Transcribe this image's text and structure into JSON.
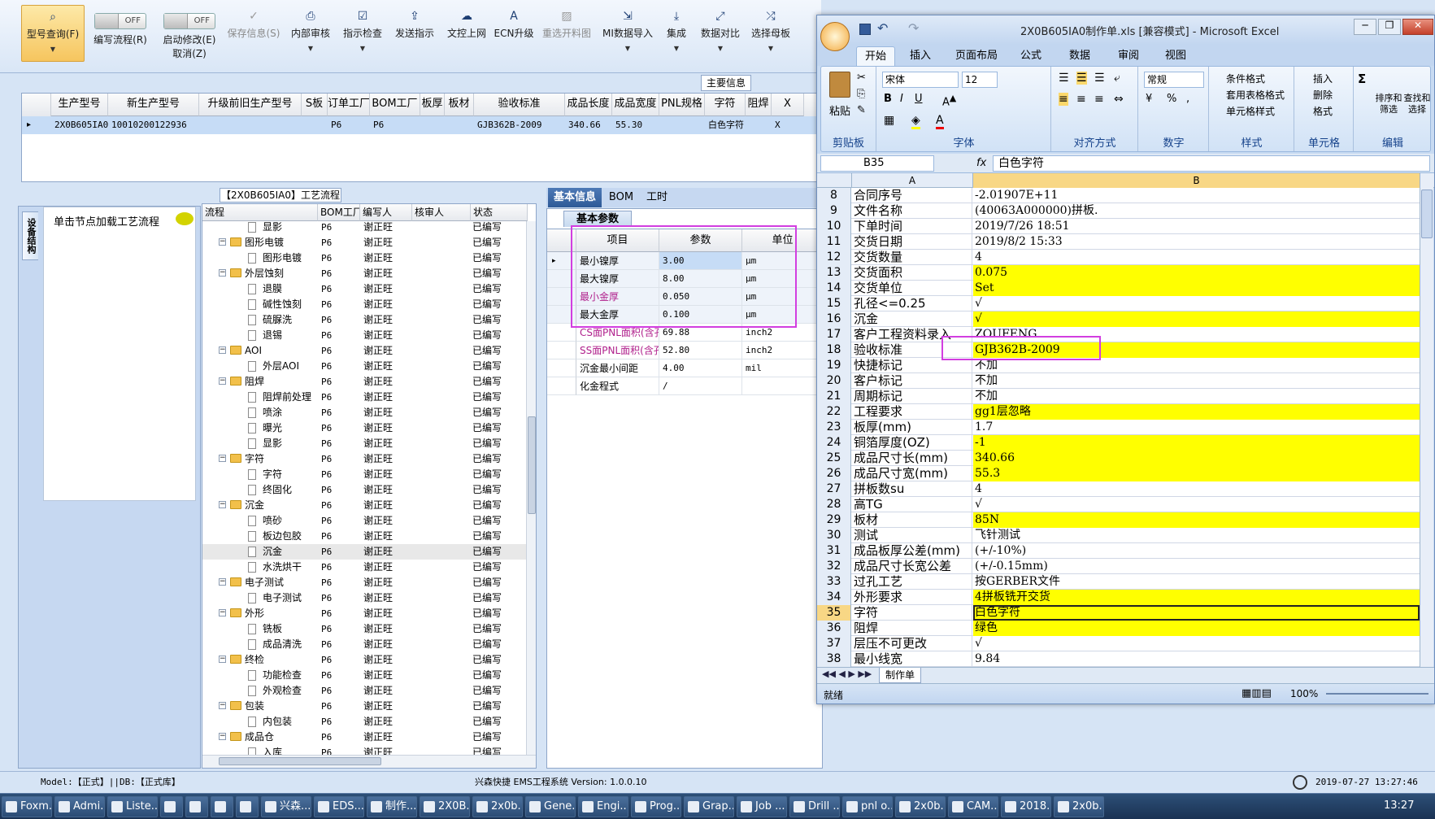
{
  "toolbar": {
    "buttons": [
      {
        "label": "型号查询(F)",
        "icon": "search-icon"
      },
      {
        "label": "编写流程(R)",
        "toggle": "OFF"
      },
      {
        "label": "启动修改(E)",
        "sub": "取消(Z)",
        "toggle": "OFF"
      },
      {
        "label": "保存信息(S)",
        "icon": "check-icon"
      },
      {
        "label": "内部审核",
        "icon": "printer-icon"
      },
      {
        "label": "指示检查",
        "icon": "check-box-icon"
      },
      {
        "label": "发送指示",
        "icon": "upload-icon"
      },
      {
        "label": "文控上网",
        "icon": "cloud-upload-icon"
      },
      {
        "label": "ECN升级",
        "icon": "a-icon"
      },
      {
        "label": "重选开料图",
        "icon": "image-icon"
      },
      {
        "label": "MI数据导入",
        "icon": "import-icon"
      },
      {
        "label": "集成",
        "icon": "download-icon"
      },
      {
        "label": "数据对比",
        "icon": "compare-icon"
      },
      {
        "label": "选择母板",
        "icon": "shuffle-icon"
      }
    ]
  },
  "main_info": {
    "tab": "主要信息",
    "columns": [
      "生产型号",
      "新生产型号",
      "升级前旧生产型号",
      "S板",
      "订单工厂",
      "BOM工厂",
      "板厚",
      "板材",
      "验收标准",
      "成品长度",
      "成品宽度",
      "PNL规格",
      "字符",
      "阻焊",
      "X"
    ],
    "row": [
      "2X0B605IA0",
      "10010200122936",
      "",
      "",
      "P6",
      "P6",
      "",
      "",
      "GJB362B-2009",
      "340.66",
      "55.30",
      "",
      "白色字符",
      "",
      "X"
    ]
  },
  "left_panel": {
    "side_tab": "设备结构",
    "hint": "单击节点加载工艺流程"
  },
  "process": {
    "title": "【2X0B605IA0】工艺流程",
    "columns": [
      "流程",
      "BOM工厂",
      "编写人",
      "核审人",
      "状态"
    ],
    "rows": [
      {
        "name": "显影",
        "level": 2,
        "factory": "P6",
        "writer": "谢正旺",
        "status": "已编写"
      },
      {
        "name": "图形电镀",
        "level": 1,
        "factory": "P6",
        "writer": "谢正旺",
        "status": "已编写"
      },
      {
        "name": "图形电镀",
        "level": 2,
        "factory": "P6",
        "writer": "谢正旺",
        "status": "已编写"
      },
      {
        "name": "外层蚀刻",
        "level": 1,
        "factory": "P6",
        "writer": "谢正旺",
        "status": "已编写"
      },
      {
        "name": "退膜",
        "level": 2,
        "factory": "P6",
        "writer": "谢正旺",
        "status": "已编写"
      },
      {
        "name": "碱性蚀刻",
        "level": 2,
        "factory": "P6",
        "writer": "谢正旺",
        "status": "已编写"
      },
      {
        "name": "硫脲洗",
        "level": 2,
        "factory": "P6",
        "writer": "谢正旺",
        "status": "已编写"
      },
      {
        "name": "退锡",
        "level": 2,
        "factory": "P6",
        "writer": "谢正旺",
        "status": "已编写"
      },
      {
        "name": "AOI",
        "level": 1,
        "factory": "P6",
        "writer": "谢正旺",
        "status": "已编写"
      },
      {
        "name": "外层AOI",
        "level": 2,
        "factory": "P6",
        "writer": "谢正旺",
        "status": "已编写"
      },
      {
        "name": "阻焊",
        "level": 1,
        "factory": "P6",
        "writer": "谢正旺",
        "status": "已编写"
      },
      {
        "name": "阻焊前处理",
        "level": 2,
        "factory": "P6",
        "writer": "谢正旺",
        "status": "已编写"
      },
      {
        "name": "喷涂",
        "level": 2,
        "factory": "P6",
        "writer": "谢正旺",
        "status": "已编写"
      },
      {
        "name": "曝光",
        "level": 2,
        "factory": "P6",
        "writer": "谢正旺",
        "status": "已编写"
      },
      {
        "name": "显影",
        "level": 2,
        "factory": "P6",
        "writer": "谢正旺",
        "status": "已编写"
      },
      {
        "name": "字符",
        "level": 1,
        "factory": "P6",
        "writer": "谢正旺",
        "status": "已编写"
      },
      {
        "name": "字符",
        "level": 2,
        "factory": "P6",
        "writer": "谢正旺",
        "status": "已编写"
      },
      {
        "name": "终固化",
        "level": 2,
        "factory": "P6",
        "writer": "谢正旺",
        "status": "已编写"
      },
      {
        "name": "沉金",
        "level": 1,
        "factory": "P6",
        "writer": "谢正旺",
        "status": "已编写"
      },
      {
        "name": "喷砂",
        "level": 2,
        "factory": "P6",
        "writer": "谢正旺",
        "status": "已编写"
      },
      {
        "name": "板边包胶",
        "level": 2,
        "factory": "P6",
        "writer": "谢正旺",
        "status": "已编写"
      },
      {
        "name": "沉金",
        "level": 2,
        "factory": "P6",
        "writer": "谢正旺",
        "status": "已编写"
      },
      {
        "name": "水洗烘干",
        "level": 2,
        "factory": "P6",
        "writer": "谢正旺",
        "status": "已编写"
      },
      {
        "name": "电子测试",
        "level": 1,
        "factory": "P6",
        "writer": "谢正旺",
        "status": "已编写"
      },
      {
        "name": "电子测试",
        "level": 2,
        "factory": "P6",
        "writer": "谢正旺",
        "status": "已编写"
      },
      {
        "name": "外形",
        "level": 1,
        "factory": "P6",
        "writer": "谢正旺",
        "status": "已编写"
      },
      {
        "name": "铣板",
        "level": 2,
        "factory": "P6",
        "writer": "谢正旺",
        "status": "已编写"
      },
      {
        "name": "成品清洗",
        "level": 2,
        "factory": "P6",
        "writer": "谢正旺",
        "status": "已编写"
      },
      {
        "name": "终检",
        "level": 1,
        "factory": "P6",
        "writer": "谢正旺",
        "status": "已编写"
      },
      {
        "name": "功能检查",
        "level": 2,
        "factory": "P6",
        "writer": "谢正旺",
        "status": "已编写"
      },
      {
        "name": "外观检查",
        "level": 2,
        "factory": "P6",
        "writer": "谢正旺",
        "status": "已编写"
      },
      {
        "name": "包装",
        "level": 1,
        "factory": "P6",
        "writer": "谢正旺",
        "status": "已编写"
      },
      {
        "name": "内包装",
        "level": 2,
        "factory": "P6",
        "writer": "谢正旺",
        "status": "已编写"
      },
      {
        "name": "成品仓",
        "level": 1,
        "factory": "P6",
        "writer": "谢正旺",
        "status": "已编写"
      },
      {
        "name": "入库",
        "level": 2,
        "factory": "P6",
        "writer": "谢正旺",
        "status": "已编写"
      }
    ]
  },
  "params": {
    "tabs": [
      "基本信息",
      "BOM",
      "工时"
    ],
    "sub_tab": "基本参数",
    "columns": [
      "项目",
      "参数",
      "单位"
    ],
    "rows": [
      {
        "item": "最小镍厚",
        "value": "3.00",
        "unit": "μm",
        "pink": false
      },
      {
        "item": "最大镍厚",
        "value": "8.00",
        "unit": "μm",
        "pink": false
      },
      {
        "item": "最小金厚",
        "value": "0.050",
        "unit": "μm",
        "pink": true
      },
      {
        "item": "最大金厚",
        "value": "0.100",
        "unit": "μm",
        "pink": false
      },
      {
        "item": "CS面PNL面积(含孔)",
        "value": "69.88",
        "unit": "inch2",
        "pink": true
      },
      {
        "item": "SS面PNL面积(含孔)",
        "value": "52.80",
        "unit": "inch2",
        "pink": true
      },
      {
        "item": "沉金最小间距",
        "value": "4.00",
        "unit": "mil",
        "pink": false
      },
      {
        "item": "化金程式",
        "value": "/",
        "unit": "",
        "pink": false
      }
    ]
  },
  "statusbar": {
    "model": "Model:【正式】||DB:【正式库】",
    "system": "兴森快捷 EMS工程系统 Version: 1.0.0.10",
    "datetime": "2019-07-27 13:27:46"
  },
  "excel": {
    "title": "2X0B605IA0制作单.xls [兼容模式] - Microsoft Excel",
    "ribbon_tabs": [
      "开始",
      "插入",
      "页面布局",
      "公式",
      "数据",
      "审阅",
      "视图"
    ],
    "font_name": "宋体",
    "font_size": "12",
    "number_format": "常规",
    "groups": [
      "剪贴板",
      "字体",
      "对齐方式",
      "数字",
      "样式",
      "单元格",
      "编辑"
    ],
    "paste": "粘贴",
    "style_items": [
      "条件格式",
      "套用表格格式",
      "单元格样式"
    ],
    "cell_items": [
      "插入",
      "删除",
      "格式"
    ],
    "edit_items": [
      "排序和筛选",
      "查找和选择"
    ],
    "name_box": "B35",
    "fx": "fx",
    "formula": "白色字符",
    "col_a": "A",
    "col_b": "B",
    "sheet_tab": "制作单",
    "status": "就绪",
    "zoom": "100%",
    "highlight_color": "#ffff00",
    "rows": [
      {
        "n": "8",
        "a": "合同序号",
        "b": "-2.01907E+11",
        "y": false
      },
      {
        "n": "9",
        "a": "文件名称",
        "b": "(40063A000000)拼板.",
        "y": false
      },
      {
        "n": "10",
        "a": "下单时间",
        "b": "2019/7/26 18:51",
        "y": false
      },
      {
        "n": "11",
        "a": "交货日期",
        "b": "2019/8/2 15:33",
        "y": false
      },
      {
        "n": "12",
        "a": "交货数量",
        "b": "4",
        "y": false
      },
      {
        "n": "13",
        "a": "交货面积",
        "b": "0.075",
        "y": true
      },
      {
        "n": "14",
        "a": "交货单位",
        "b": "Set",
        "y": true
      },
      {
        "n": "15",
        "a": "孔径<=0.25",
        "b": "√",
        "y": false
      },
      {
        "n": "16",
        "a": "沉金",
        "b": "√",
        "y": true
      },
      {
        "n": "17",
        "a": "客户工程资料录入",
        "b": "ZOUFENG",
        "y": false
      },
      {
        "n": "18",
        "a": "验收标准",
        "b": "GJB362B-2009",
        "y": true
      },
      {
        "n": "19",
        "a": "快捷标记",
        "b": "不加",
        "y": false
      },
      {
        "n": "20",
        "a": "客户标记",
        "b": "不加",
        "y": false
      },
      {
        "n": "21",
        "a": "周期标记",
        "b": "不加",
        "y": false
      },
      {
        "n": "22",
        "a": "工程要求",
        "b": "gg1层忽略",
        "y": true
      },
      {
        "n": "23",
        "a": "板厚(mm)",
        "b": "1.7",
        "y": false
      },
      {
        "n": "24",
        "a": "铜箔厚度(OZ)",
        "b": "-1",
        "y": true
      },
      {
        "n": "25",
        "a": "成品尺寸长(mm)",
        "b": "340.66",
        "y": true
      },
      {
        "n": "26",
        "a": "成品尺寸宽(mm)",
        "b": "55.3",
        "y": true
      },
      {
        "n": "27",
        "a": "拼板数su",
        "b": "4",
        "y": false
      },
      {
        "n": "28",
        "a": "高TG",
        "b": "√",
        "y": false
      },
      {
        "n": "29",
        "a": "板材",
        "b": "85N",
        "y": true
      },
      {
        "n": "30",
        "a": "测试",
        "b": "飞针测试",
        "y": false
      },
      {
        "n": "31",
        "a": "成品板厚公差(mm)",
        "b": "(+/-10%)",
        "y": false
      },
      {
        "n": "32",
        "a": "成品尺寸长宽公差",
        "b": "(+/-0.15mm)",
        "y": false
      },
      {
        "n": "33",
        "a": "过孔工艺",
        "b": "按GERBER文件",
        "y": false
      },
      {
        "n": "34",
        "a": "外形要求",
        "b": "4拼板铣开交货",
        "y": true
      },
      {
        "n": "35",
        "a": "字符",
        "b": "白色字符",
        "y": true
      },
      {
        "n": "36",
        "a": "阻焊",
        "b": "绿色",
        "y": true
      },
      {
        "n": "37",
        "a": "层压不可更改",
        "b": "√",
        "y": false
      },
      {
        "n": "38",
        "a": "最小线宽",
        "b": "9.84",
        "y": false
      }
    ]
  },
  "taskbar": {
    "items": [
      "Foxm...",
      "Admi...",
      "Liste...",
      "",
      "",
      "",
      "",
      "兴森...",
      "EDS...",
      "制作...",
      "2X0B...",
      "2x0b...",
      "Gene...",
      "Engi...",
      "Prog...",
      "Grap...",
      "Job ...",
      "Drill ...",
      "pnl o...",
      "2x0b...",
      "CAM...",
      "2018...",
      "2x0b..."
    ],
    "clock": "13:27"
  }
}
